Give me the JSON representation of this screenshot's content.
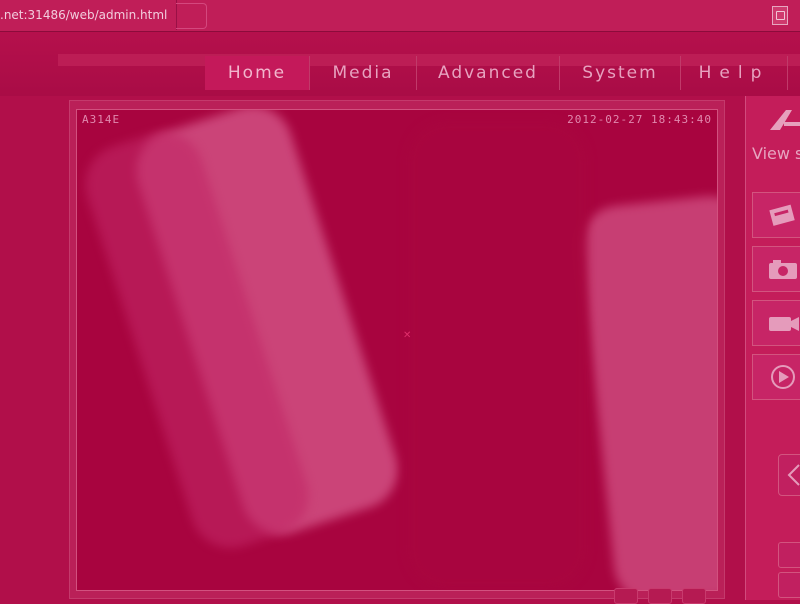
{
  "browser": {
    "url": ".net:31486/web/admin.html"
  },
  "nav": {
    "items": [
      {
        "label": "Home",
        "active": true
      },
      {
        "label": "Media",
        "active": false
      },
      {
        "label": "Advanced",
        "active": false
      },
      {
        "label": "System",
        "active": false
      },
      {
        "label": "Help",
        "active": false
      }
    ]
  },
  "viewer": {
    "camera_id": "A314E",
    "timestamp": "2012-02-27 18:43:40"
  },
  "panel": {
    "label": "View s"
  },
  "colors": {
    "tint": "#b10f4a",
    "panel": "#c41d5a"
  }
}
